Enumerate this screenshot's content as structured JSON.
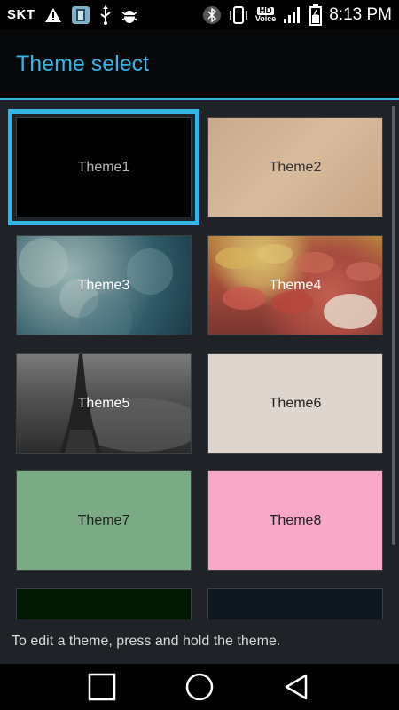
{
  "status_bar": {
    "carrier": "SKT",
    "hd_label": "HD",
    "voice_label": "Voice",
    "time": "8:13 PM",
    "icons": [
      "warning-icon",
      "app-notification-icon",
      "usb-icon",
      "debug-android-icon",
      "bluetooth-icon",
      "vibrate-icon",
      "hd-voice-icon",
      "signal-icon",
      "battery-icon"
    ]
  },
  "action_bar": {
    "title": "Theme select"
  },
  "themes": [
    {
      "label": "Theme1",
      "selected": true,
      "color": "#000000"
    },
    {
      "label": "Theme2",
      "selected": false,
      "color": "#d2b393"
    },
    {
      "label": "Theme3",
      "selected": false,
      "color": "#3d6a76"
    },
    {
      "label": "Theme4",
      "selected": false,
      "color": "#a34b3b"
    },
    {
      "label": "Theme5",
      "selected": false,
      "color": "#555555"
    },
    {
      "label": "Theme6",
      "selected": false,
      "color": "#ddd5ce"
    },
    {
      "label": "Theme7",
      "selected": false,
      "color": "#7aab84"
    },
    {
      "label": "Theme8",
      "selected": false,
      "color": "#f7a8c6"
    },
    {
      "label": "",
      "selected": false,
      "color": "#021a03"
    },
    {
      "label": "",
      "selected": false,
      "color": "#10181f"
    }
  ],
  "hint": "To edit a theme, press and hold the theme.",
  "nav": {
    "buttons": [
      "recent-apps-icon",
      "home-icon",
      "back-icon"
    ]
  },
  "colors": {
    "accent": "#33b5e5",
    "background": "#1f2328"
  }
}
